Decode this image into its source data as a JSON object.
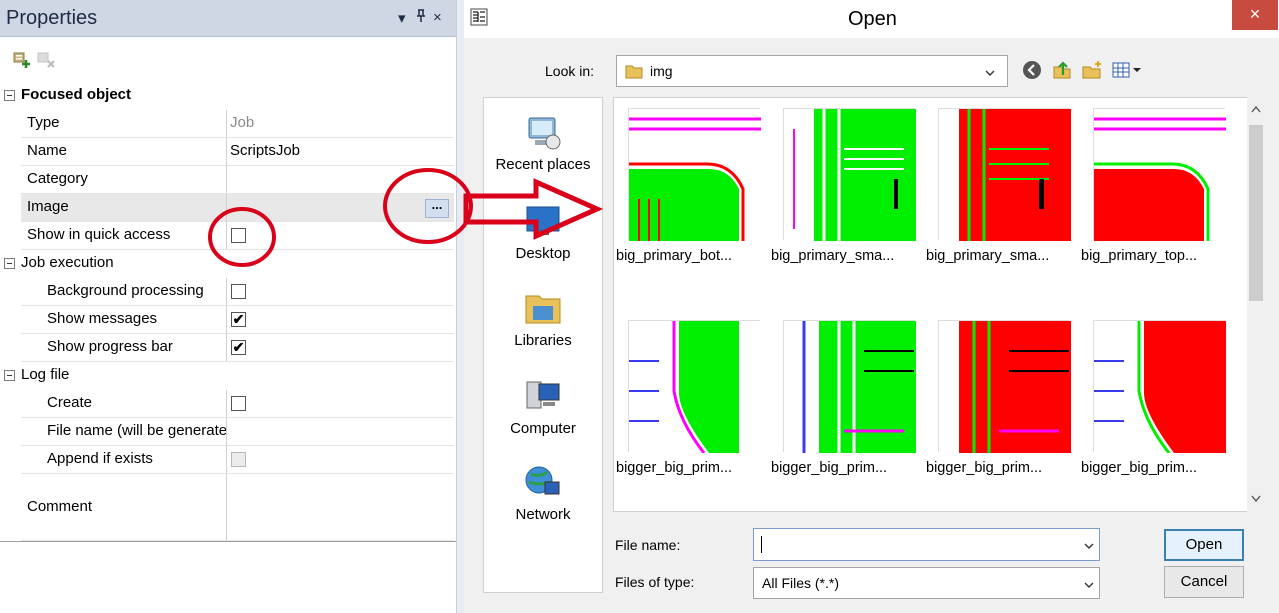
{
  "properties_panel": {
    "title": "Properties",
    "title_buttons": {
      "dropdown": "▾",
      "pin": "ᵖ",
      "close": "×"
    },
    "categories": [
      {
        "label": "Focused object",
        "rows": [
          {
            "label": "Type",
            "value": "Job"
          },
          {
            "label": "Name",
            "value": "ScriptsJob"
          },
          {
            "label": "Category",
            "value": ""
          },
          {
            "label": "Image",
            "value": "",
            "ellipsis": "..."
          },
          {
            "label": "Show in quick access",
            "checked": false
          }
        ]
      },
      {
        "label": "Job execution",
        "rows": [
          {
            "label": "Background processing",
            "checked": false
          },
          {
            "label": "Show messages",
            "checked": true
          },
          {
            "label": "Show progress bar",
            "checked": true
          }
        ]
      },
      {
        "label": "Log file",
        "rows": [
          {
            "label": "Create",
            "checked": false
          },
          {
            "label": "File name (will be generated)",
            "value": ""
          },
          {
            "label": "Append if exists",
            "checked": false,
            "disabled": true
          }
        ]
      }
    ],
    "comment_label": "Comment",
    "check_glyph": "✔"
  },
  "open_dialog": {
    "title": "Open",
    "close_glyph": "×",
    "look_in_label": "Look in:",
    "look_in_value": "img",
    "places": [
      "Recent places",
      "Desktop",
      "Libraries",
      "Computer",
      "Network"
    ],
    "files": [
      {
        "name": "big_primary_bot...",
        "variant": "a"
      },
      {
        "name": "big_primary_sma...",
        "variant": "b"
      },
      {
        "name": "big_primary_sma...",
        "variant": "c"
      },
      {
        "name": "big_primary_top...",
        "variant": "d"
      },
      {
        "name": "bigger_big_prim...",
        "variant": "e"
      },
      {
        "name": "bigger_big_prim...",
        "variant": "f"
      },
      {
        "name": "bigger_big_prim...",
        "variant": "g"
      },
      {
        "name": "bigger_big_prim...",
        "variant": "h"
      }
    ],
    "file_name_label": "File name:",
    "file_name_value": "",
    "file_type_label": "Files of type:",
    "file_type_value": "All Files (*.*)",
    "open_button": "Open",
    "cancel_button": "Cancel"
  },
  "colors": {
    "accent_red": "#d9001a",
    "pcb_green": "#00ef00",
    "pcb_red": "#ff0000",
    "pcb_magenta": "#ff00ff",
    "pcb_blue": "#3a3af0"
  },
  "icons": {
    "toolbar": [
      "add-filter-icon",
      "remove-filter-icon"
    ],
    "dialog_toolbar": [
      "back-icon",
      "up-folder-icon",
      "new-folder-icon",
      "view-menu-icon"
    ]
  }
}
